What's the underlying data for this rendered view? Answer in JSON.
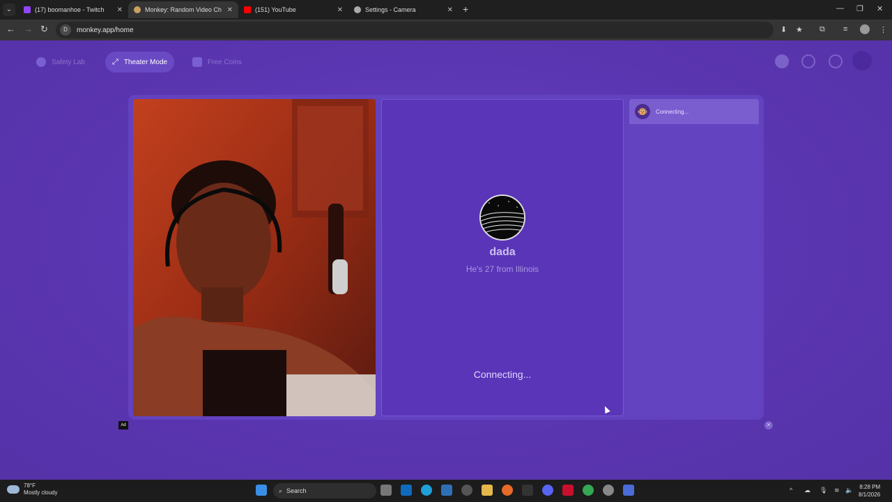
{
  "browser": {
    "tabs": [
      {
        "title": "(17) boomanhoe - Twitch",
        "color": "#9146ff"
      },
      {
        "title": "Monkey: Random Video Ch",
        "color": "#caa060"
      },
      {
        "title": "(151) YouTube",
        "color": "#ff0000"
      },
      {
        "title": "Settings - Camera",
        "color": "#aaaaaa"
      }
    ],
    "url": "monkey.app/home"
  },
  "page": {
    "nav": {
      "safety_lab": "Safety Lab",
      "theater_mode": "Theater Mode",
      "free_coins": "Free Coins"
    },
    "peer": {
      "name": "dada",
      "subtitle": "He's 27 from Illinois",
      "status": "Connecting..."
    },
    "chat": {
      "status": "Connecting..."
    },
    "ad_label": "Ad",
    "ad_close": "✕"
  },
  "taskbar": {
    "weather_temp": "78°F",
    "weather_desc": "Mostly cloudy",
    "search_placeholder": "Search",
    "time": "8:28 PM",
    "date": "8/1/2026"
  }
}
